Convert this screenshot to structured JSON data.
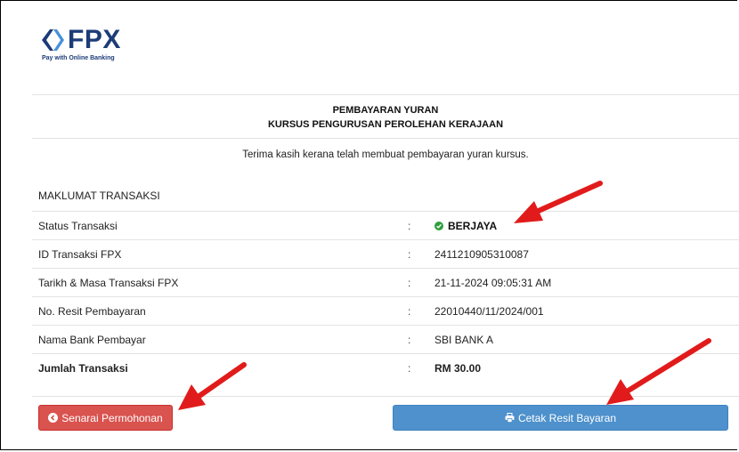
{
  "logo": {
    "name": "FPX",
    "tagline": "Pay with Online Banking"
  },
  "heading": {
    "line1": "PEMBAYARAN YURAN",
    "line2": "KURSUS PENGURUSAN PEROLEHAN KERAJAAN"
  },
  "message": "Terima kasih kerana telah membuat pembayaran yuran kursus.",
  "section_title": "MAKLUMAT TRANSAKSI",
  "separator": ":",
  "rows": [
    {
      "label": "Status Transaksi",
      "value": "BERJAYA"
    },
    {
      "label": "ID Transaksi FPX",
      "value": "2411210905310087"
    },
    {
      "label": "Tarikh & Masa Transaksi FPX",
      "value": "21-11-2024 09:05:31 AM"
    },
    {
      "label": "No. Resit Pembayaran",
      "value": "22010440/11/2024/001"
    },
    {
      "label": "Nama Bank Pembayar",
      "value": "SBI BANK A"
    },
    {
      "label": "Jumlah Transaksi",
      "value": "RM 30.00"
    }
  ],
  "buttons": {
    "back_label": "Senarai Permohonan",
    "print_label": "Cetak Resit Bayaran"
  },
  "colors": {
    "brand": "#1c3c78",
    "success": "#2e9e3e",
    "danger": "#d9534f",
    "primary": "#4e91cc",
    "annotation_arrow": "#e11b1b"
  },
  "icons": {
    "logo": "fpx-chevrons-icon",
    "status": "check-circle-icon",
    "back": "chevron-circle-left-icon",
    "print": "print-icon"
  }
}
